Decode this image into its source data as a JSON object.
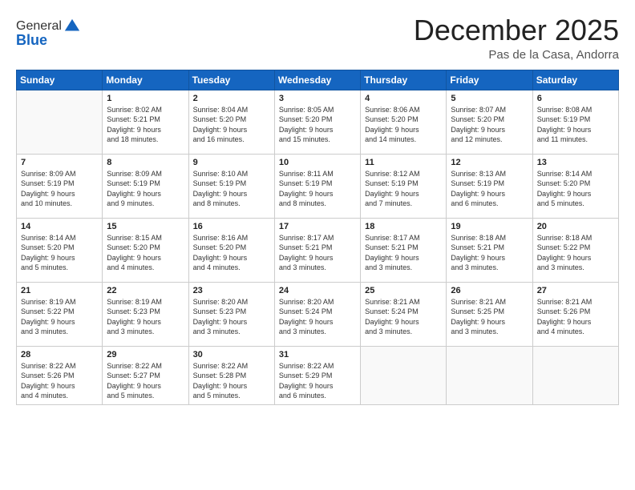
{
  "logo": {
    "general": "General",
    "blue": "Blue"
  },
  "header": {
    "month": "December 2025",
    "location": "Pas de la Casa, Andorra"
  },
  "weekdays": [
    "Sunday",
    "Monday",
    "Tuesday",
    "Wednesday",
    "Thursday",
    "Friday",
    "Saturday"
  ],
  "weeks": [
    [
      {
        "day": "",
        "info": ""
      },
      {
        "day": "1",
        "info": "Sunrise: 8:02 AM\nSunset: 5:21 PM\nDaylight: 9 hours\nand 18 minutes."
      },
      {
        "day": "2",
        "info": "Sunrise: 8:04 AM\nSunset: 5:20 PM\nDaylight: 9 hours\nand 16 minutes."
      },
      {
        "day": "3",
        "info": "Sunrise: 8:05 AM\nSunset: 5:20 PM\nDaylight: 9 hours\nand 15 minutes."
      },
      {
        "day": "4",
        "info": "Sunrise: 8:06 AM\nSunset: 5:20 PM\nDaylight: 9 hours\nand 14 minutes."
      },
      {
        "day": "5",
        "info": "Sunrise: 8:07 AM\nSunset: 5:20 PM\nDaylight: 9 hours\nand 12 minutes."
      },
      {
        "day": "6",
        "info": "Sunrise: 8:08 AM\nSunset: 5:19 PM\nDaylight: 9 hours\nand 11 minutes."
      }
    ],
    [
      {
        "day": "7",
        "info": "Sunrise: 8:09 AM\nSunset: 5:19 PM\nDaylight: 9 hours\nand 10 minutes."
      },
      {
        "day": "8",
        "info": "Sunrise: 8:09 AM\nSunset: 5:19 PM\nDaylight: 9 hours\nand 9 minutes."
      },
      {
        "day": "9",
        "info": "Sunrise: 8:10 AM\nSunset: 5:19 PM\nDaylight: 9 hours\nand 8 minutes."
      },
      {
        "day": "10",
        "info": "Sunrise: 8:11 AM\nSunset: 5:19 PM\nDaylight: 9 hours\nand 8 minutes."
      },
      {
        "day": "11",
        "info": "Sunrise: 8:12 AM\nSunset: 5:19 PM\nDaylight: 9 hours\nand 7 minutes."
      },
      {
        "day": "12",
        "info": "Sunrise: 8:13 AM\nSunset: 5:19 PM\nDaylight: 9 hours\nand 6 minutes."
      },
      {
        "day": "13",
        "info": "Sunrise: 8:14 AM\nSunset: 5:20 PM\nDaylight: 9 hours\nand 5 minutes."
      }
    ],
    [
      {
        "day": "14",
        "info": "Sunrise: 8:14 AM\nSunset: 5:20 PM\nDaylight: 9 hours\nand 5 minutes."
      },
      {
        "day": "15",
        "info": "Sunrise: 8:15 AM\nSunset: 5:20 PM\nDaylight: 9 hours\nand 4 minutes."
      },
      {
        "day": "16",
        "info": "Sunrise: 8:16 AM\nSunset: 5:20 PM\nDaylight: 9 hours\nand 4 minutes."
      },
      {
        "day": "17",
        "info": "Sunrise: 8:17 AM\nSunset: 5:21 PM\nDaylight: 9 hours\nand 3 minutes."
      },
      {
        "day": "18",
        "info": "Sunrise: 8:17 AM\nSunset: 5:21 PM\nDaylight: 9 hours\nand 3 minutes."
      },
      {
        "day": "19",
        "info": "Sunrise: 8:18 AM\nSunset: 5:21 PM\nDaylight: 9 hours\nand 3 minutes."
      },
      {
        "day": "20",
        "info": "Sunrise: 8:18 AM\nSunset: 5:22 PM\nDaylight: 9 hours\nand 3 minutes."
      }
    ],
    [
      {
        "day": "21",
        "info": "Sunrise: 8:19 AM\nSunset: 5:22 PM\nDaylight: 9 hours\nand 3 minutes."
      },
      {
        "day": "22",
        "info": "Sunrise: 8:19 AM\nSunset: 5:23 PM\nDaylight: 9 hours\nand 3 minutes."
      },
      {
        "day": "23",
        "info": "Sunrise: 8:20 AM\nSunset: 5:23 PM\nDaylight: 9 hours\nand 3 minutes."
      },
      {
        "day": "24",
        "info": "Sunrise: 8:20 AM\nSunset: 5:24 PM\nDaylight: 9 hours\nand 3 minutes."
      },
      {
        "day": "25",
        "info": "Sunrise: 8:21 AM\nSunset: 5:24 PM\nDaylight: 9 hours\nand 3 minutes."
      },
      {
        "day": "26",
        "info": "Sunrise: 8:21 AM\nSunset: 5:25 PM\nDaylight: 9 hours\nand 3 minutes."
      },
      {
        "day": "27",
        "info": "Sunrise: 8:21 AM\nSunset: 5:26 PM\nDaylight: 9 hours\nand 4 minutes."
      }
    ],
    [
      {
        "day": "28",
        "info": "Sunrise: 8:22 AM\nSunset: 5:26 PM\nDaylight: 9 hours\nand 4 minutes."
      },
      {
        "day": "29",
        "info": "Sunrise: 8:22 AM\nSunset: 5:27 PM\nDaylight: 9 hours\nand 5 minutes."
      },
      {
        "day": "30",
        "info": "Sunrise: 8:22 AM\nSunset: 5:28 PM\nDaylight: 9 hours\nand 5 minutes."
      },
      {
        "day": "31",
        "info": "Sunrise: 8:22 AM\nSunset: 5:29 PM\nDaylight: 9 hours\nand 6 minutes."
      },
      {
        "day": "",
        "info": ""
      },
      {
        "day": "",
        "info": ""
      },
      {
        "day": "",
        "info": ""
      }
    ]
  ]
}
